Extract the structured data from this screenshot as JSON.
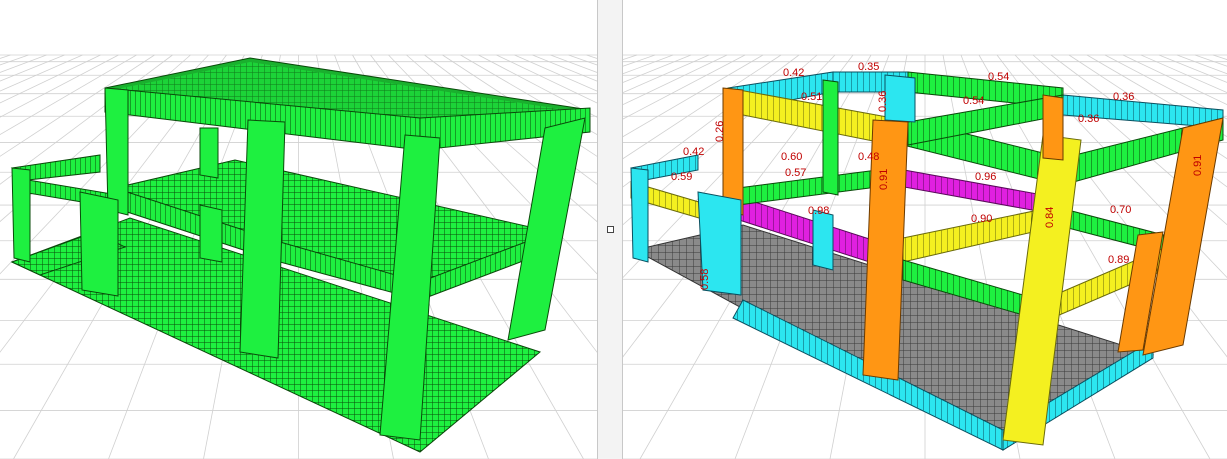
{
  "colors": {
    "ok_green": "#1ef040",
    "cyan": "#2ce6f0",
    "yellow": "#f4f020",
    "orange": "#ff9614",
    "magenta": "#e020e0",
    "label_red": "#c00000",
    "grid": "#d0d0d0",
    "support_green": "#1a9a1a"
  },
  "left_view": {
    "description_icon": "3d-structural-model"
  },
  "right_view": {
    "ratio_labels": [
      "0.42",
      "0.35",
      "0.54",
      "0.36",
      "0.51",
      "0.36",
      "0.26",
      "0.42",
      "0.54",
      "0.60",
      "0.48",
      "0.57",
      "0.91",
      "0.96",
      "0.98",
      "0.90",
      "0.84",
      "0.70",
      "0.89",
      "0.91",
      "0.59",
      "0.36",
      "0.58"
    ]
  }
}
